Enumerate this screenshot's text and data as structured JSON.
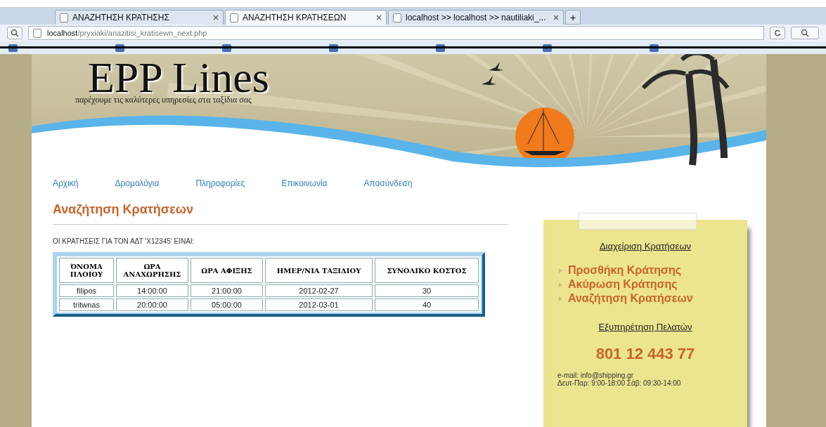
{
  "browser": {
    "tabs": [
      {
        "label": "ΑΝΑΖΗΤΗΣΗ ΚΡΑΤΗΣΗΣ",
        "selected": false
      },
      {
        "label": "ΑΝΑΖΗΤΗΣΗ ΚΡΑΤΗΣΕΩΝ",
        "selected": true
      },
      {
        "label": "localhost >> localhost >> nautiliaki_...",
        "selected": false
      }
    ],
    "new_tab": "+",
    "address": {
      "host": "localhost",
      "path": "/pryxiaki/anazitisi_kratisewn_next.php"
    }
  },
  "site": {
    "logo": "EPP Lines",
    "tagline": "παρέχουμε τις καλύτερες υπηρεσίες στα ταξίδια σας",
    "nav": [
      "Αρχική",
      "Δρομολόγια",
      "Πληροφορίες",
      "Επικοινωνία",
      "Αποσύνδεση"
    ]
  },
  "main": {
    "title": "Αναζήτηση Κρατήσεων",
    "intro": "ΟΙ ΚΡΑΤΗΣΕΙΣ ΓΙΑ ΤΟΝ ΑΔΤ 'Χ12345' ΕΙΝΑΙ:",
    "table": {
      "columns": [
        "ΌΝΟΜΑ ΠΛΟΙΟΥ",
        "ΩΡΑ ΑΝΑΧΩΡΗΣΗΣ",
        "ΩΡΑ ΑΦΙΞΗΣ",
        "ΗΜΕΡ/ΝΙΑ ΤΑΞΙΔΙΟΥ",
        "ΣΥΝΟΛΙΚΟ ΚΟΣΤΟΣ"
      ],
      "rows": [
        [
          "filipos",
          "14:00:00",
          "21:00:00",
          "2012-02-27",
          "30"
        ],
        [
          "tritwnas",
          "20:00:00",
          "05:00:00",
          "2012-03-01",
          "40"
        ]
      ]
    }
  },
  "sidebar": {
    "heading": "Διαχείριση Κρατήσεων",
    "links": [
      "Προσθήκη Κράτησης",
      "Ακύρωση Κράτησης",
      "Αναζήτηση Κρατήσεων"
    ],
    "support_heading": "Εξυπηρέτηση Πελατών",
    "phone": "801 12 443 77",
    "email": "e-mail: info@shipping.gr",
    "hours": "Δευτ-Παρ: 9:00-18:00 Σάβ: 09:30-14:00"
  }
}
